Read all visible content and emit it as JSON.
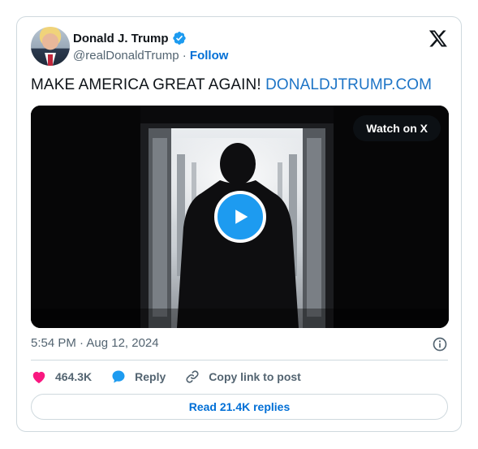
{
  "author": {
    "name": "Donald J. Trump",
    "handle": "@realDonaldTrump",
    "separator": "·",
    "follow_label": "Follow",
    "verified": true
  },
  "tweet": {
    "text": "MAKE AMERICA GREAT AGAIN! ",
    "link_text": "DONALDJTRUMP.COM"
  },
  "media": {
    "watch_label": "Watch on X",
    "type": "video"
  },
  "timestamp": "5:54 PM · Aug 12, 2024",
  "actions": {
    "like_count": "464.3K",
    "reply_label": "Reply",
    "copy_label": "Copy link to post"
  },
  "read_replies_label": "Read 21.4K replies",
  "colors": {
    "brand_blue": "#1d9bf0",
    "link_blue": "#006fd6",
    "like_pink": "#f91880",
    "muted_text": "#536471",
    "border": "#cfd9de"
  },
  "icons": [
    "verified-badge-icon",
    "x-logo-icon",
    "play-icon",
    "info-icon",
    "heart-icon",
    "reply-bubble-icon",
    "link-icon"
  ]
}
